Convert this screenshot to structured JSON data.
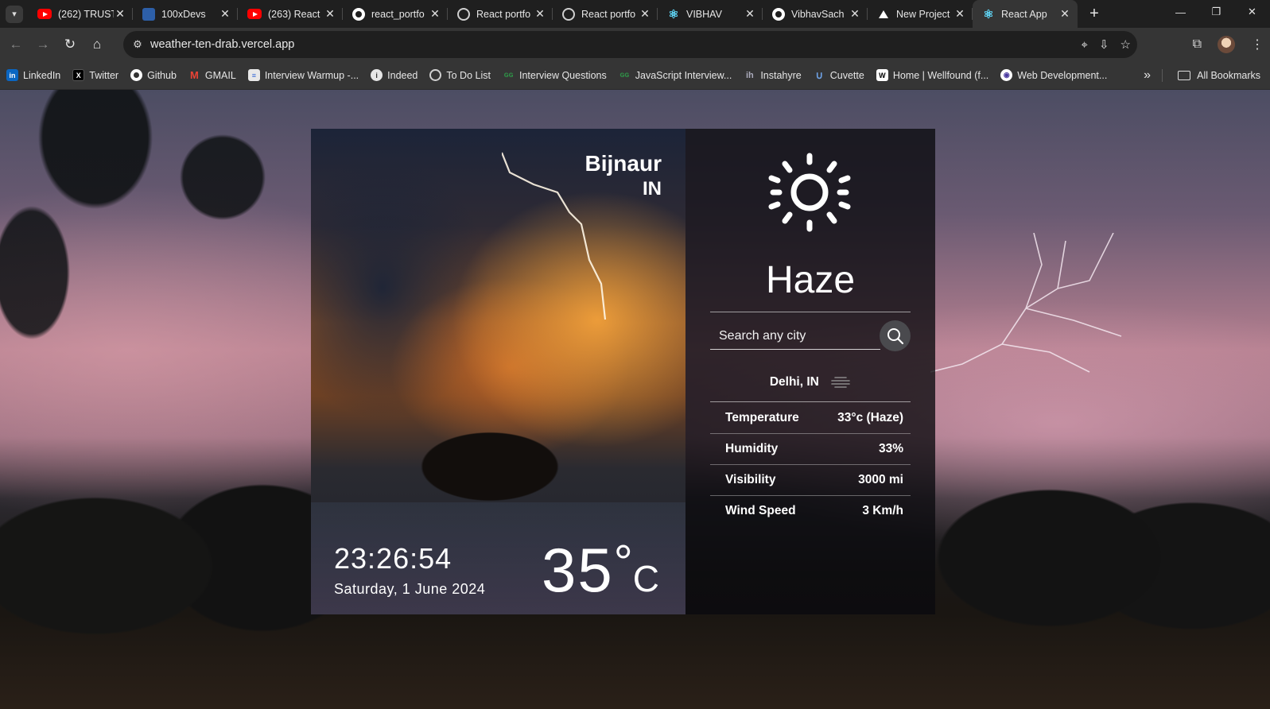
{
  "browser": {
    "tabs": [
      {
        "title": "(262) TRUST",
        "icon": "youtube-icon"
      },
      {
        "title": "100xDevs",
        "icon": "100xdevs-icon"
      },
      {
        "title": "(263) React",
        "icon": "youtube-icon"
      },
      {
        "title": "react_portfo",
        "icon": "github-icon"
      },
      {
        "title": "React portfo",
        "icon": "globe-icon"
      },
      {
        "title": "React portfo",
        "icon": "globe-icon"
      },
      {
        "title": "VIBHAV",
        "icon": "react-icon"
      },
      {
        "title": "VibhavSach",
        "icon": "github-icon"
      },
      {
        "title": "New Project",
        "icon": "vercel-icon"
      },
      {
        "title": "React App",
        "icon": "react-icon",
        "active": true
      }
    ],
    "url": "weather-ten-drab.vercel.app",
    "bookmarks": [
      {
        "label": "LinkedIn",
        "icon": "linkedin-icon"
      },
      {
        "label": "Twitter",
        "icon": "x-icon"
      },
      {
        "label": "Github",
        "icon": "github-icon"
      },
      {
        "label": "GMAIL",
        "icon": "gmail-icon"
      },
      {
        "label": "Interview Warmup -...",
        "icon": "doc-icon"
      },
      {
        "label": "Indeed",
        "icon": "info-icon"
      },
      {
        "label": "To Do List",
        "icon": "globe-icon"
      },
      {
        "label": "Interview Questions",
        "icon": "gfg-icon"
      },
      {
        "label": "JavaScript Interview...",
        "icon": "gfg-icon"
      },
      {
        "label": "Instahyre",
        "icon": "instahyre-icon"
      },
      {
        "label": "Cuvette",
        "icon": "cuvette-icon"
      },
      {
        "label": "Home | Wellfound (f...",
        "icon": "wellfound-icon"
      },
      {
        "label": "Web Development...",
        "icon": "webdev-icon"
      }
    ],
    "all_bookmarks": "All Bookmarks"
  },
  "weather": {
    "city": "Bijnaur",
    "country": "IN",
    "time": "23:26:54",
    "date": "Saturday, 1 June 2024",
    "temp": "35",
    "temp_degree": "°",
    "temp_unit": "C",
    "condition": "Haze",
    "search_placeholder": "Search any city",
    "location": "Delhi, IN",
    "stats": [
      {
        "label": "Temperature",
        "value": "33°c (Haze)"
      },
      {
        "label": "Humidity",
        "value": "33%"
      },
      {
        "label": "Visibility",
        "value": "3000 mi"
      },
      {
        "label": "Wind Speed",
        "value": "3 Km/h"
      }
    ]
  }
}
